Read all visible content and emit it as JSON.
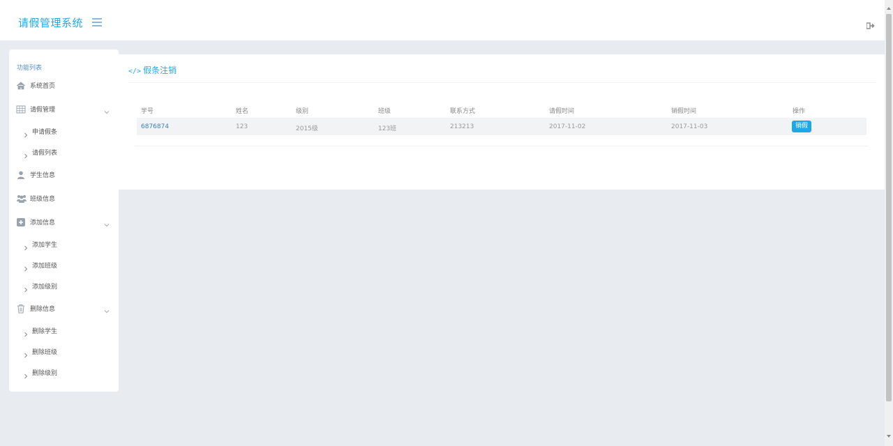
{
  "header": {
    "brand": "请假管理系统",
    "menu_icon": "list-icon",
    "logout_icon": "sign-out-icon"
  },
  "sidebar": {
    "section_title": "功能列表",
    "items": [
      {
        "label": "系统首页",
        "icon": "home-icon"
      },
      {
        "label": "请假管理",
        "icon": "table-icon",
        "expanded": true,
        "children": [
          "申请假条",
          "请假列表"
        ]
      },
      {
        "label": "学生信息",
        "icon": "user-icon"
      },
      {
        "label": "班级信息",
        "icon": "group-icon"
      },
      {
        "label": "添加信息",
        "icon": "plus-square-icon",
        "expanded": true,
        "children": [
          "添加学生",
          "添加班级",
          "添加级别"
        ]
      },
      {
        "label": "删除信息",
        "icon": "trash-icon",
        "expanded": true,
        "children": [
          "删除学生",
          "删除班级",
          "删除级别"
        ]
      }
    ]
  },
  "main": {
    "title_icon": "</>",
    "title": "假条注销",
    "table": {
      "headers": [
        "学号",
        "姓名",
        "级别",
        "班级",
        "联系方式",
        "请假时间",
        "销假时间",
        "操作"
      ],
      "rows": [
        {
          "id": "6876874",
          "name": "123",
          "level": "2015级",
          "class": "123班",
          "contact": "213213",
          "leave_time": "2017-11-02",
          "return_time": "2017-11-03",
          "action": "销假"
        }
      ]
    }
  },
  "colors": {
    "accent": "#29a6e0",
    "button": "#1ca8e6",
    "background": "#e8ebf0"
  }
}
